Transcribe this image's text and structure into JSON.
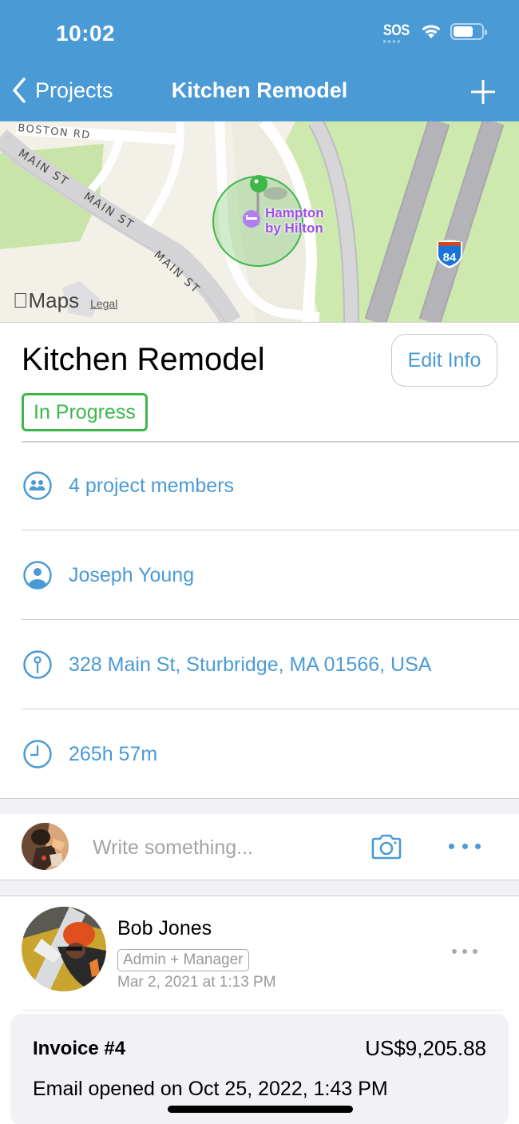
{
  "status_bar": {
    "time": "10:02",
    "sos_label": "SOS",
    "wifi_icon": "wifi-icon",
    "battery_icon": "battery-icon",
    "battery_level": 0.7
  },
  "nav": {
    "back_label": "Projects",
    "back_icon": "chevron-left-icon",
    "title": "Kitchen Remodel",
    "add_icon": "plus-icon"
  },
  "map": {
    "road_labels": [
      "BOSTON RD",
      "MAIN ST",
      "MAIN ST",
      "MAIN ST"
    ],
    "poi_name_line1": "Hampton",
    "poi_name_line2": "by Hilton",
    "poi_icon": "bed-icon",
    "highway_shield": "84",
    "maps_brand": "Maps",
    "legal_label": "Legal",
    "pin_icon": "map-pin-icon"
  },
  "project": {
    "title": "Kitchen Remodel",
    "edit_button": "Edit Info",
    "status": "In Progress",
    "status_color": "#3cb84a"
  },
  "info_rows": [
    {
      "icon": "group-icon",
      "text": "4 project members"
    },
    {
      "icon": "person-icon",
      "text": "Joseph Young"
    },
    {
      "icon": "location-pin-icon",
      "text": "328 Main St, Sturbridge, MA 01566, USA"
    },
    {
      "icon": "clock-icon",
      "text": "265h 57m"
    }
  ],
  "compose": {
    "placeholder": "Write something...",
    "camera_icon": "camera-icon",
    "more_icon": "more-horizontal-icon"
  },
  "post": {
    "author": "Bob Jones",
    "role": "Admin + Manager",
    "date": "Mar 2, 2021 at 1:13 PM",
    "more_icon": "more-horizontal-icon",
    "invoice": {
      "title": "Invoice #4",
      "amount": "US$9,205.88",
      "status": "Email opened on Oct 25, 2022, 1:43 PM"
    }
  },
  "colors": {
    "accent": "#4a9ad6",
    "header_bg": "#4a9ad6",
    "status_green": "#3cb84a",
    "poi_purple": "#9d4fe6",
    "secondary_text": "#98989d"
  }
}
